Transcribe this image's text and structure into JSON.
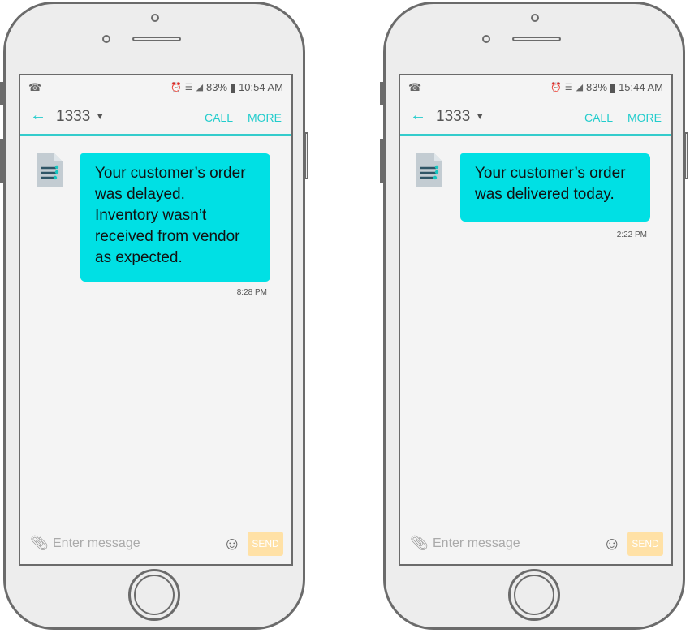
{
  "phones": [
    {
      "status": {
        "left_icon": "phone-wifi-icon",
        "alarm_icon": "alarm-icon",
        "wifi_icon": "wifi-icon",
        "signal_icon": "signal-icon",
        "battery_percent": "83%",
        "battery_icon": "battery-icon",
        "time": "10:54 AM"
      },
      "app_bar": {
        "back_icon": "arrow-left-icon",
        "contact": "1333",
        "contact_caret_icon": "caret-down-icon",
        "call_label": "CALL",
        "more_label": "MORE"
      },
      "messages": [
        {
          "avatar_icon": "document-icon",
          "lines": [
            "Your customer’s order",
            "was delayed.",
            "Inventory wasn’t",
            "received from vendor",
            "as expected."
          ],
          "time": "8:28 PM"
        }
      ],
      "compose": {
        "attach_icon": "paperclip-icon",
        "placeholder": "Enter message",
        "value": "",
        "emoji_icon": "smiley-icon",
        "send_label": "SEND"
      }
    },
    {
      "status": {
        "left_icon": "phone-wifi-icon",
        "alarm_icon": "alarm-icon",
        "wifi_icon": "wifi-icon",
        "signal_icon": "signal-icon",
        "battery_percent": "83%",
        "battery_icon": "battery-icon",
        "time": "15:44 AM"
      },
      "app_bar": {
        "back_icon": "arrow-left-icon",
        "contact": "1333",
        "contact_caret_icon": "caret-down-icon",
        "call_label": "CALL",
        "more_label": "MORE"
      },
      "messages": [
        {
          "avatar_icon": "document-icon",
          "lines": [
            "Your customer’s order",
            "was delivered today."
          ],
          "time": "2:22 PM"
        }
      ],
      "compose": {
        "attach_icon": "paperclip-icon",
        "placeholder": "Enter message",
        "value": "",
        "emoji_icon": "smiley-icon",
        "send_label": "SEND"
      }
    }
  ],
  "colors": {
    "accent": "#22cccc",
    "bubble": "#00e0e4",
    "send_button": "#ffe1a6",
    "frame": "#6b6b6b"
  }
}
